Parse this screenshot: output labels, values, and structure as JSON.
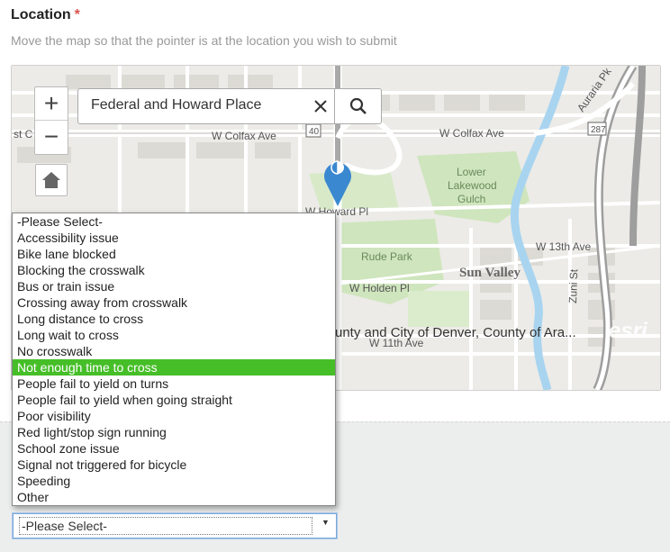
{
  "field": {
    "label": "Location",
    "required_mark": "*",
    "hint": "Move the map so that the pointer is at the location you wish to submit"
  },
  "map": {
    "search_value": "Federal and Howard Place",
    "zoom_in": "+",
    "zoom_out": "−",
    "labels": {
      "colfax_left": "W Colfax Ave",
      "colfax_right": "W Colfax Ave",
      "hwy40": "40",
      "hwy287": "287",
      "howard": "W Howard Pl",
      "lower_lakewood": [
        "Lower",
        "Lakewood",
        "Gulch"
      ],
      "rude_park": "Rude Park",
      "sun_valley": "Sun Valley",
      "holden": "W Holden Pl",
      "thirteenth": "W 13th Ave",
      "eleventh": "W 11th Ave",
      "zuni": "Zuni St",
      "auraria": "Auraria Pk",
      "st_fragment": "st C"
    },
    "attribution": "unty and City of Denver, County of Ara...",
    "logo": "esri",
    "colors": {
      "pin": "#3a88d0",
      "park": "#cfe5bd",
      "river": "#a8d4f0",
      "road": "#ffffff"
    }
  },
  "dropdown": {
    "options": [
      "-Please Select-",
      "Accessibility issue",
      "Bike lane blocked",
      "Blocking the crosswalk",
      "Bus or train issue",
      "Crossing away from crosswalk",
      "Long distance to cross",
      "Long wait to cross",
      "No crosswalk",
      "Not enough time to cross",
      "People fail to yield on turns",
      "People fail to yield when going straight",
      "Poor visibility",
      "Red light/stop sign running",
      "School zone issue",
      "Signal not triggered for bicycle",
      "Speeding",
      "Other"
    ],
    "highlighted": "Not enough time to cross",
    "current_value": "-Please Select-",
    "highlight_color": "#46be28"
  }
}
